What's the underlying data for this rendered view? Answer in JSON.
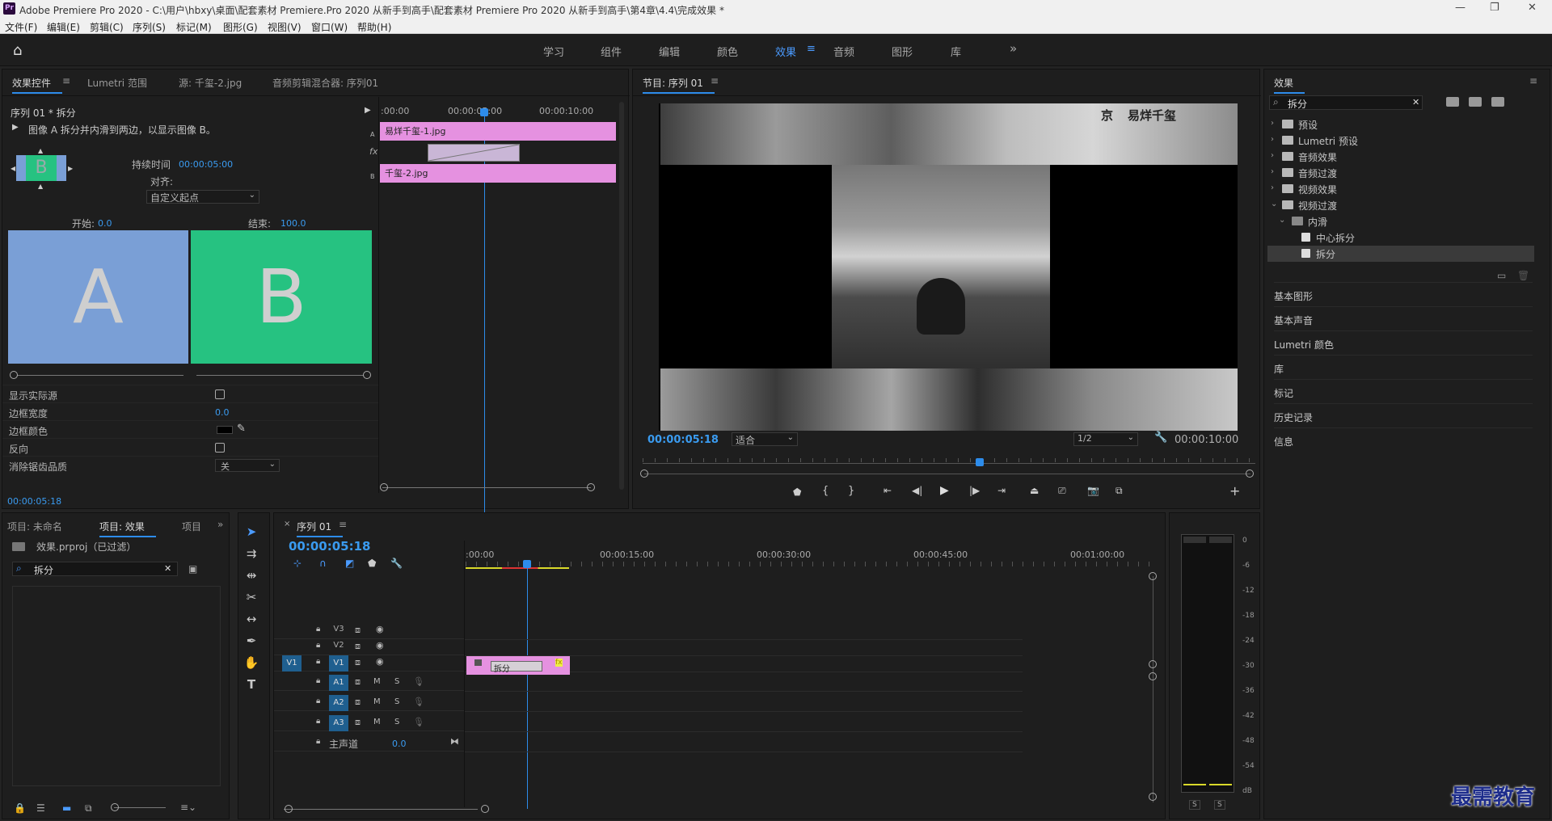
{
  "window": {
    "app_icon": "Pr",
    "title": "Adobe Premiere Pro 2020 - C:\\用户\\hbxy\\桌面\\配套素材 Premiere.Pro 2020 从新手到高手\\配套素材 Premiere Pro 2020 从新手到高手\\第4章\\4.4\\完成效果 *"
  },
  "menu": [
    "文件(F)",
    "编辑(E)",
    "剪辑(C)",
    "序列(S)",
    "标记(M)",
    "图形(G)",
    "视图(V)",
    "窗口(W)",
    "帮助(H)"
  ],
  "workspaces": [
    "学习",
    "组件",
    "编辑",
    "颜色",
    "效果",
    "音频",
    "图形",
    "库"
  ],
  "workspace_active": "效果",
  "effect_controls": {
    "tabs": [
      "效果控件",
      "Lumetri 范围",
      "源: 千玺-2.jpg",
      "音频剪辑混合器: 序列01"
    ],
    "clip_path": "序列 01 * 拆分",
    "description": "图像 A 拆分并内滑到两边，以显示图像 B。",
    "duration_label": "持续时间",
    "duration_value": "00:00:05:00",
    "align_label": "对齐:",
    "align_value": "自定义起点",
    "start_label": "开始:",
    "start_value": "0.0",
    "end_label": "结束:",
    "end_value": "100.0",
    "preview_a": "A",
    "preview_b": "B",
    "thumb_label": "B",
    "mini_times": [
      ":00:00",
      "00:00:05:00",
      "00:00:10:00"
    ],
    "mini_clip_a": "易烊千玺-1.jpg",
    "mini_clip_b": "千玺-2.jpg",
    "track_a": "A",
    "track_b": "B",
    "fx_label": "fx",
    "props": [
      {
        "label": "显示实际源",
        "type": "checkbox"
      },
      {
        "label": "边框宽度",
        "type": "value",
        "value": "0.0"
      },
      {
        "label": "边框颜色",
        "type": "color"
      },
      {
        "label": "反向",
        "type": "checkbox"
      },
      {
        "label": "消除锯齿品质",
        "type": "select",
        "value": "关"
      }
    ],
    "current_time": "00:00:05:18"
  },
  "program": {
    "title": "节目: 序列 01",
    "timecode": "00:00:05:18",
    "fit": "适合",
    "resolution": "1/2",
    "duration": "00:00:10:00",
    "poster_text_left": "京",
    "poster_text_right": "易烊千玺",
    "playhead": 0.55
  },
  "project": {
    "tabs": [
      "项目: 未命名",
      "项目: 效果",
      "项目"
    ],
    "file": "效果.prproj（已过滤）",
    "search": "拆分"
  },
  "timeline": {
    "tab": "序列 01",
    "timecode": "00:00:05:18",
    "ruler": [
      ":00:00",
      "00:00:15:00",
      "00:00:30:00",
      "00:00:45:00",
      "00:01:00:00"
    ],
    "tracks": [
      {
        "id": "V3",
        "kind": "video"
      },
      {
        "id": "V2",
        "kind": "video"
      },
      {
        "id": "V1",
        "kind": "video",
        "source": "V1"
      },
      {
        "id": "A1",
        "kind": "audio",
        "m": "M",
        "s": "S"
      },
      {
        "id": "A2",
        "kind": "audio",
        "m": "M",
        "s": "S"
      },
      {
        "id": "A3",
        "kind": "audio",
        "m": "M",
        "s": "S"
      }
    ],
    "master_label": "主声道",
    "master_value": "0.0",
    "clip_transition": "拆分",
    "clip_fx": "fx"
  },
  "meter": {
    "scale": [
      "0",
      "-6",
      "-12",
      "-18",
      "-24",
      "-30",
      "-36",
      "-42",
      "-48",
      "-54",
      "dB"
    ],
    "solo": [
      "S",
      "S"
    ]
  },
  "effects_panel": {
    "title": "效果",
    "search": "拆分",
    "tree": [
      {
        "label": "预设",
        "level": 0,
        "open": false
      },
      {
        "label": "Lumetri 预设",
        "level": 0,
        "open": false
      },
      {
        "label": "音频效果",
        "level": 0,
        "open": false
      },
      {
        "label": "音频过渡",
        "level": 0,
        "open": false
      },
      {
        "label": "视频效果",
        "level": 0,
        "open": false
      },
      {
        "label": "视频过渡",
        "level": 0,
        "open": true
      },
      {
        "label": "内滑",
        "level": 1,
        "open": true
      },
      {
        "label": "中心拆分",
        "level": 2,
        "open": false
      },
      {
        "label": "拆分",
        "level": 2,
        "open": false,
        "selected": true
      }
    ],
    "side_panels": [
      "基本图形",
      "基本声音",
      "Lumetri 颜色",
      "库",
      "标记",
      "历史记录",
      "信息"
    ]
  },
  "watermark": "最需教育",
  "colors": {
    "accent": "#2d8ceb",
    "clip_pink": "#e591e0",
    "preview_a": "#7a9fd6",
    "preview_b": "#26c281",
    "track_target": "#1f5f8f"
  }
}
